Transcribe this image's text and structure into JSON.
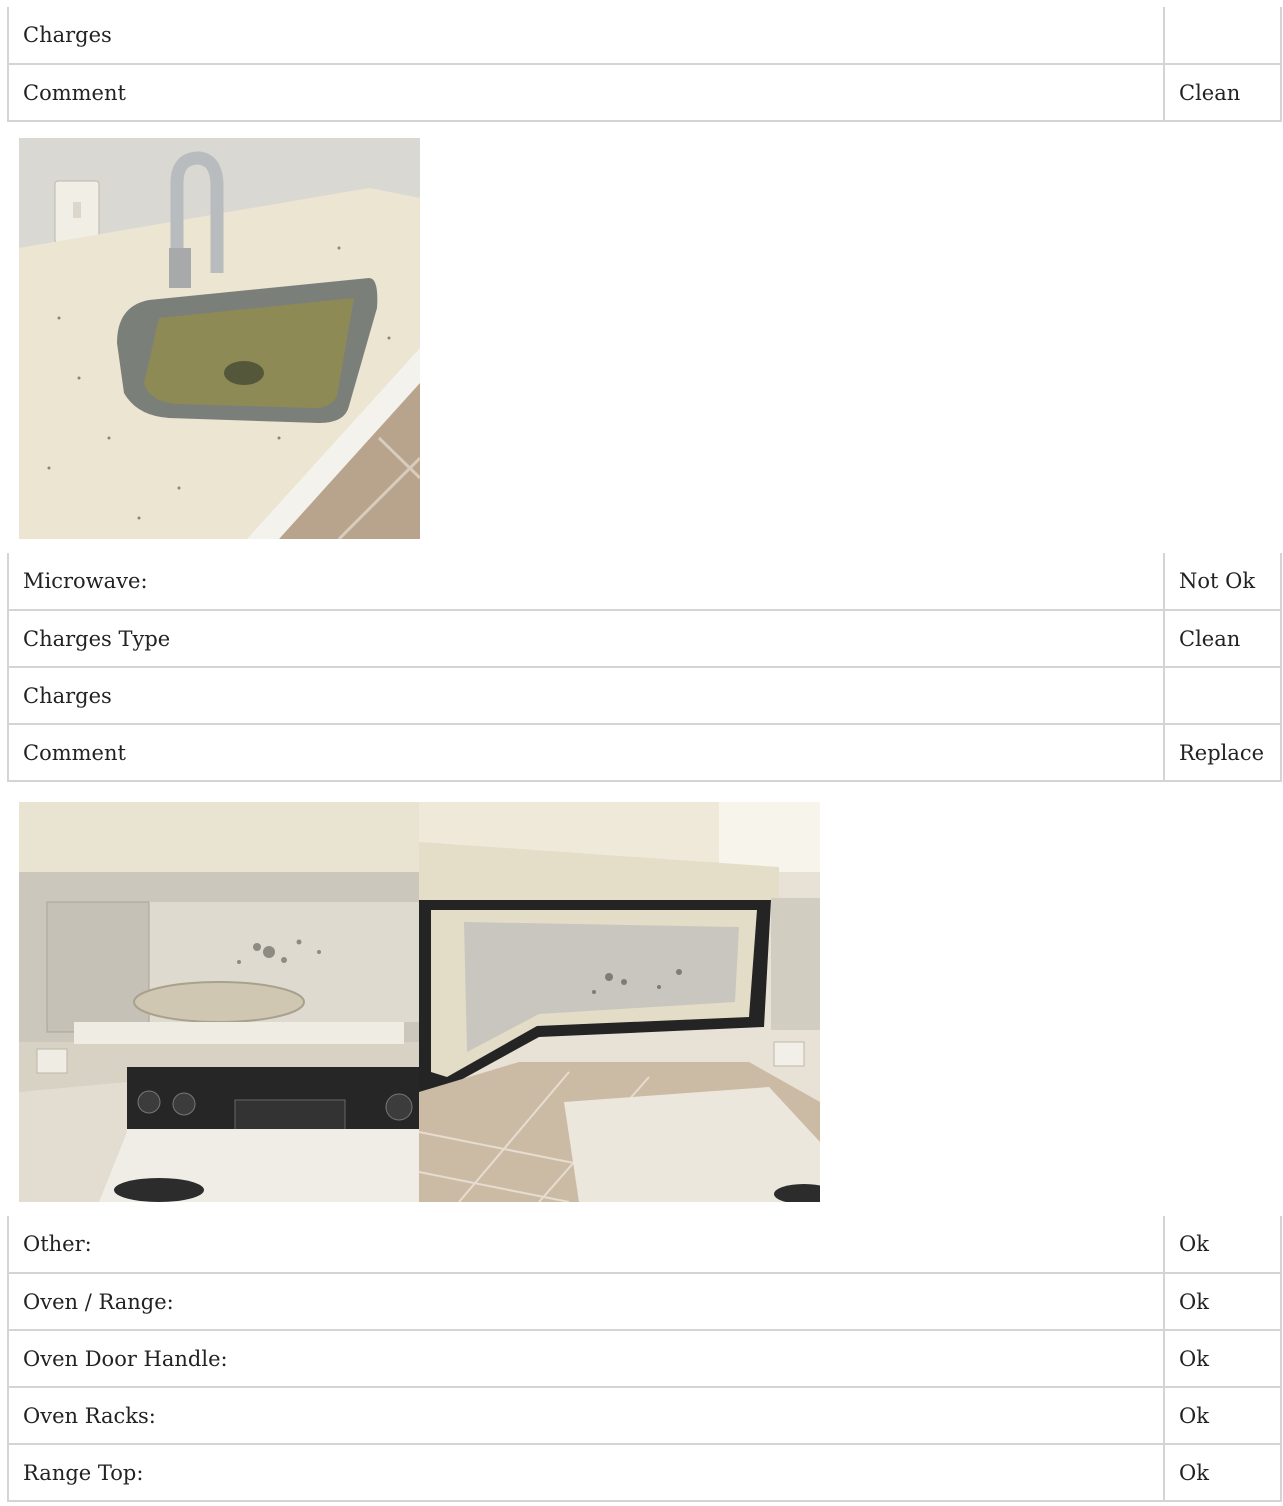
{
  "section1": {
    "rows": [
      {
        "label": "Charges",
        "value": ""
      },
      {
        "label": "Comment",
        "value": "Clean"
      }
    ]
  },
  "section2": {
    "rows": [
      {
        "label": "Microwave:",
        "value": "Not Ok"
      },
      {
        "label": "Charges Type",
        "value": "Clean"
      },
      {
        "label": "Charges",
        "value": ""
      },
      {
        "label": "Comment",
        "value": "Replace"
      }
    ]
  },
  "section3": {
    "rows": [
      {
        "label": "Other:",
        "value": "Ok"
      },
      {
        "label": "Oven / Range:",
        "value": "Ok"
      },
      {
        "label": "Oven Door Handle:",
        "value": "Ok"
      },
      {
        "label": "Oven Racks:",
        "value": "Ok"
      },
      {
        "label": "Range Top:",
        "value": "Ok"
      }
    ]
  },
  "photos": {
    "sink_photo": "kitchen-sink-photo",
    "microwave_interior_photo": "microwave-interior-photo",
    "microwave_door_photo": "microwave-door-photo"
  }
}
